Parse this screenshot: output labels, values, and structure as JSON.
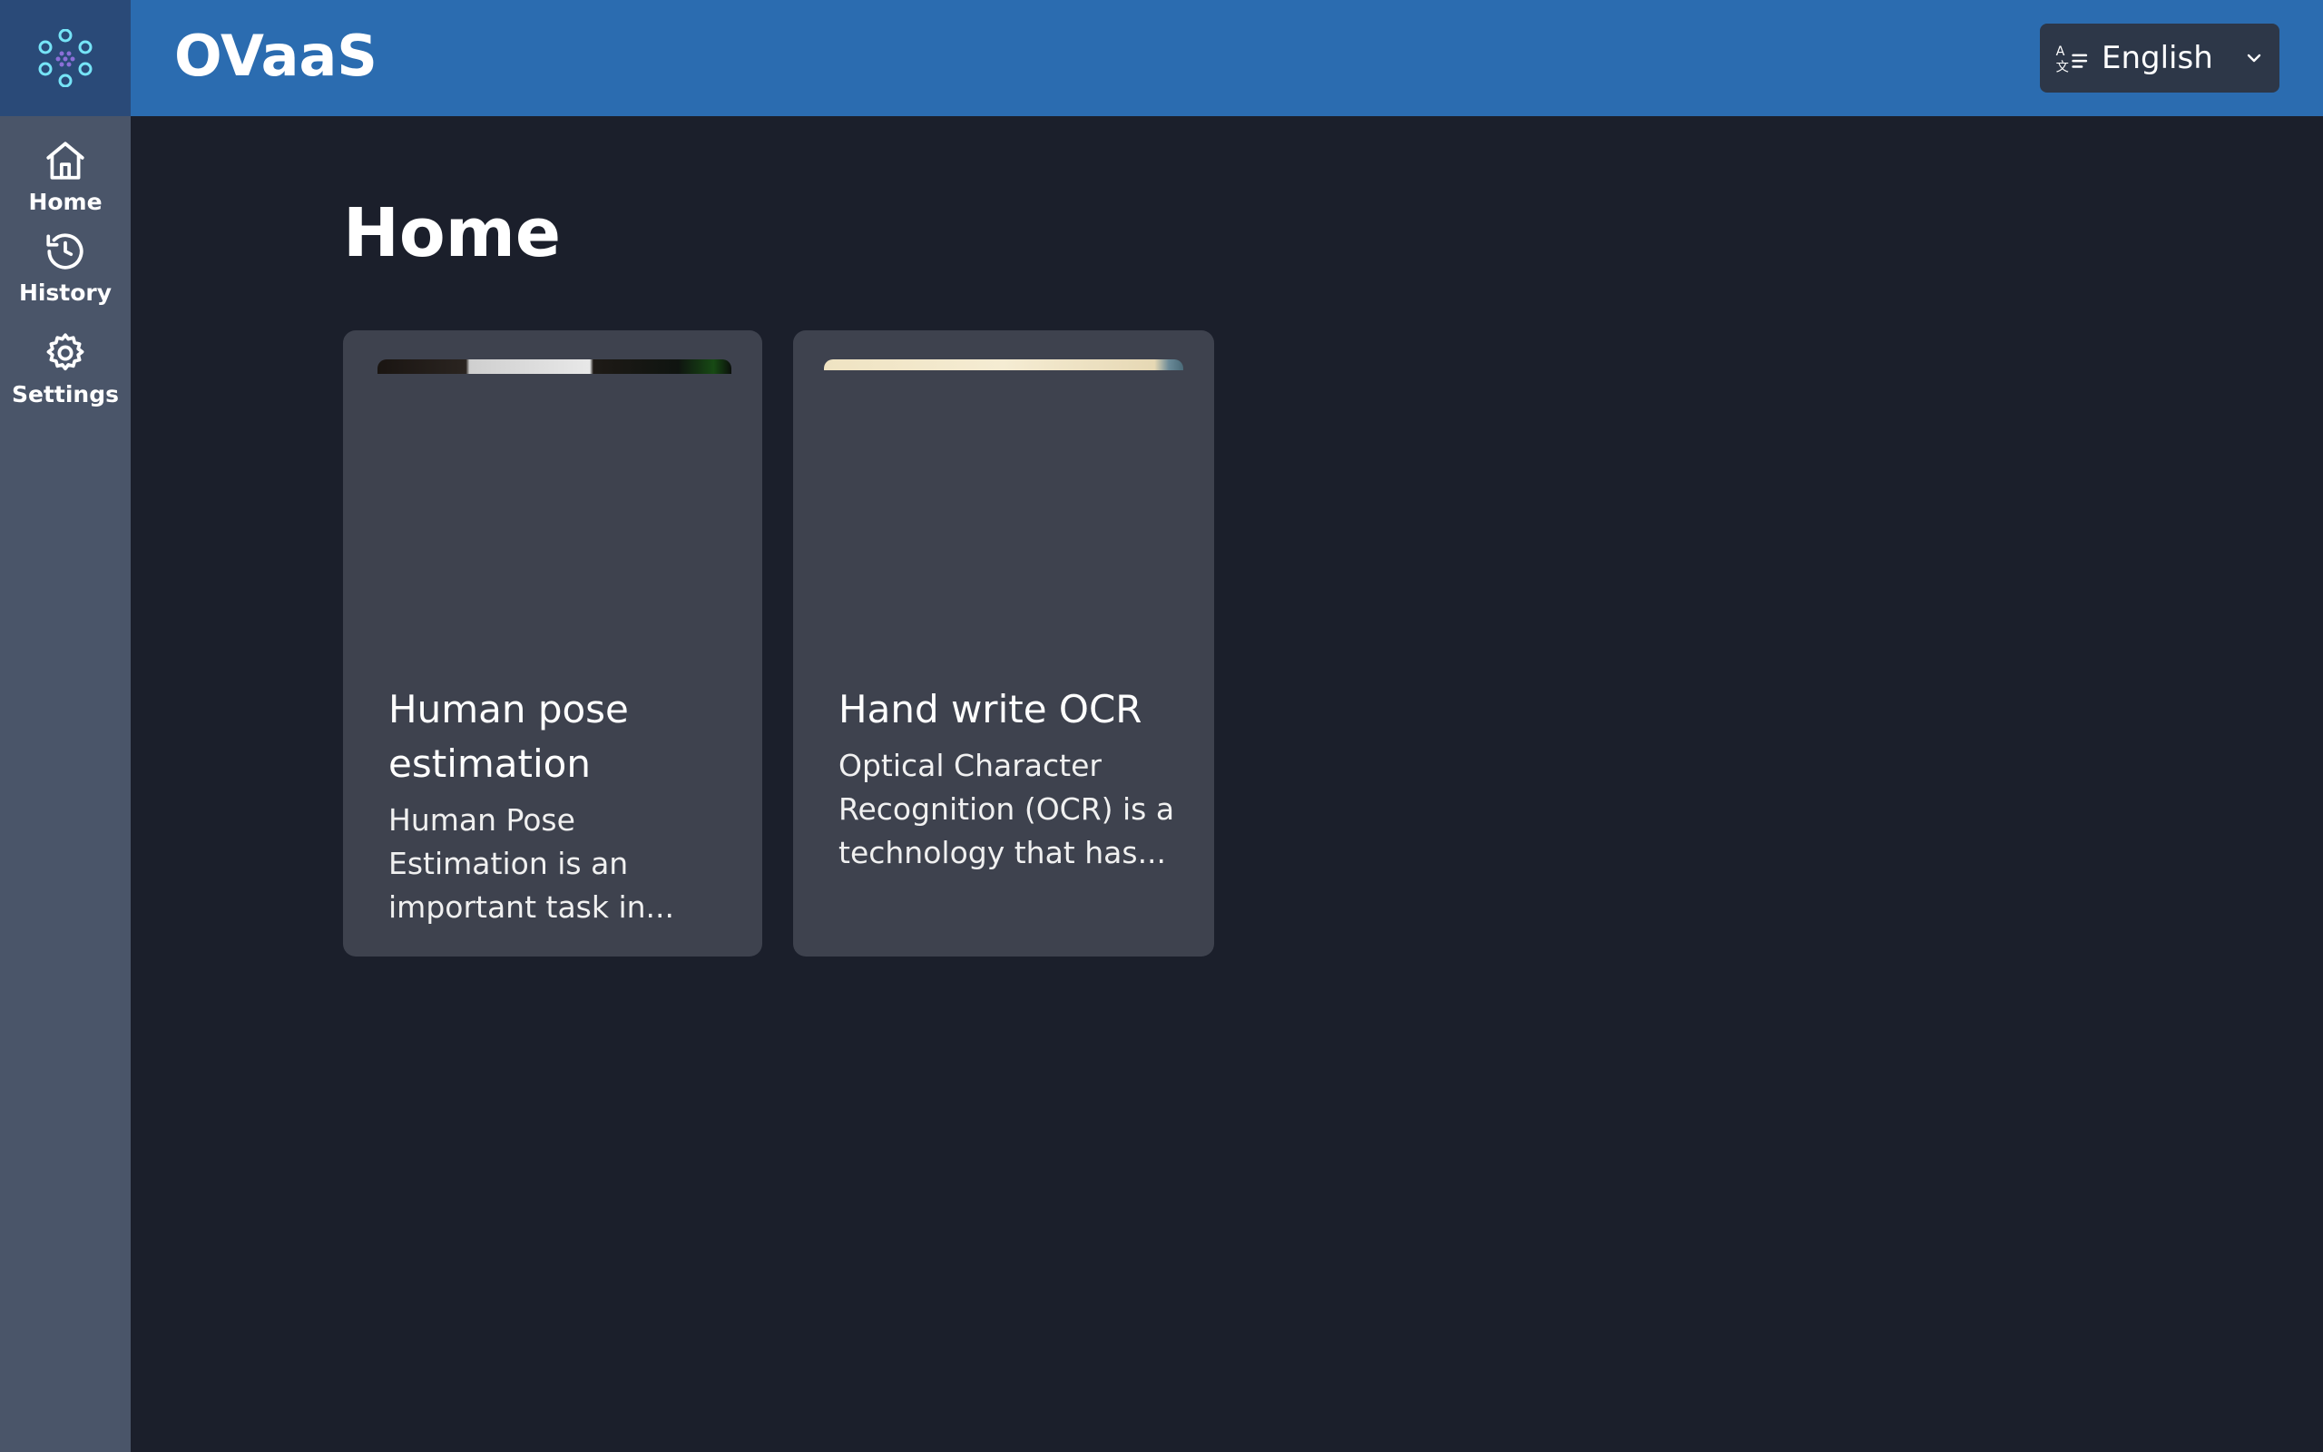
{
  "app": {
    "title": "OVaaS"
  },
  "sidebar": {
    "logo_icon": "molecule-logo-icon",
    "items": [
      {
        "label": "Home",
        "icon": "home-icon"
      },
      {
        "label": "History",
        "icon": "history-icon"
      },
      {
        "label": "Settings",
        "icon": "gear-icon"
      }
    ]
  },
  "header": {
    "language": {
      "selected": "English",
      "icon": "translate-icon"
    }
  },
  "main": {
    "title": "Home",
    "cards": [
      {
        "title": "Human pose estimation",
        "description": "Human Pose Estimation is an important task in..."
      },
      {
        "title": "Hand write OCR",
        "description": "Optical Character Recognition (OCR) is a technology that has..."
      }
    ]
  },
  "colors": {
    "header_bg": "#2b6cb0",
    "sidebar_bg": "#4a5569",
    "logo_bg": "#2a4a78",
    "main_bg": "#1b1f2b",
    "card_bg": "#3e424e",
    "select_bg": "#2d3748",
    "logo_accent": "#76e4f7"
  }
}
